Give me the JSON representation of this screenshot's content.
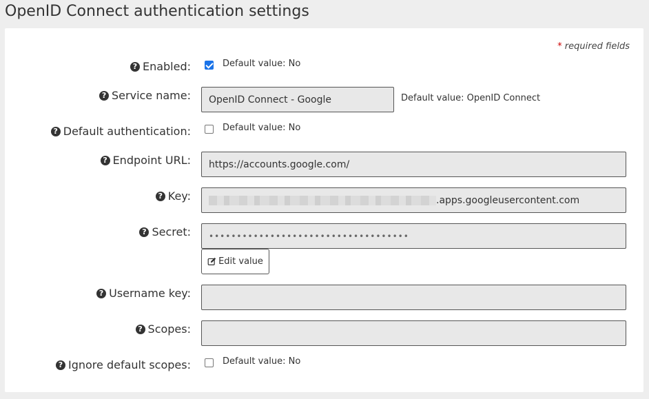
{
  "title": "OpenID Connect authentication settings",
  "required_note": {
    "star": "*",
    "text": "required fields"
  },
  "fields": {
    "enabled": {
      "label": "Enabled:",
      "checked": true,
      "hint": "Default value: No"
    },
    "service_name": {
      "label": "Service name:",
      "value": "OpenID Connect - Google",
      "hint": "Default value: OpenID Connect"
    },
    "default_auth": {
      "label": "Default authentication:",
      "checked": false,
      "hint": "Default value: No"
    },
    "endpoint_url": {
      "label": "Endpoint URL:",
      "value": "https://accounts.google.com/"
    },
    "key": {
      "label": "Key:",
      "value_suffix": ".apps.googleusercontent.com"
    },
    "secret": {
      "label": "Secret:",
      "value": "••••••••••••••••••••••••••••••••••••",
      "edit_label": "Edit value"
    },
    "username_key": {
      "label": "Username key:",
      "value": ""
    },
    "scopes": {
      "label": "Scopes:",
      "value": ""
    },
    "ignore_default_scopes": {
      "label": "Ignore default scopes:",
      "checked": false,
      "hint": "Default value: No"
    }
  },
  "icons": {
    "help": "question-circle-icon",
    "edit": "pencil-square-icon"
  },
  "colors": {
    "checkbox_checked": "#1a73e8",
    "required_star": "#cc0000"
  }
}
